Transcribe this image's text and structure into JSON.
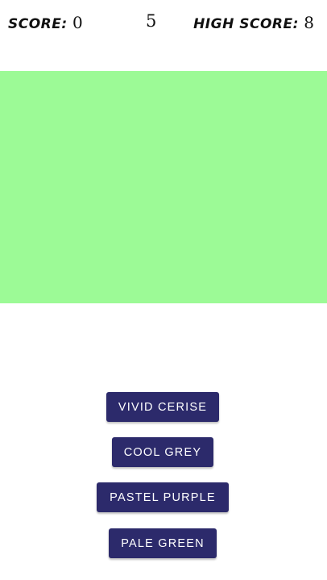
{
  "hud": {
    "score_label": "SCORE:",
    "score_value": "0",
    "timer": "5",
    "high_score_label": "HIGH SCORE:",
    "high_score_value": "8"
  },
  "swatch": {
    "color": "#9cfa96"
  },
  "answers": [
    {
      "label": "VIVID CERISE"
    },
    {
      "label": "COOL GREY"
    },
    {
      "label": "PASTEL PURPLE"
    },
    {
      "label": "PALE GREEN"
    }
  ],
  "colors": {
    "button_bg": "#2c2a6b",
    "button_text": "#ffffff",
    "background": "#ffffff"
  }
}
